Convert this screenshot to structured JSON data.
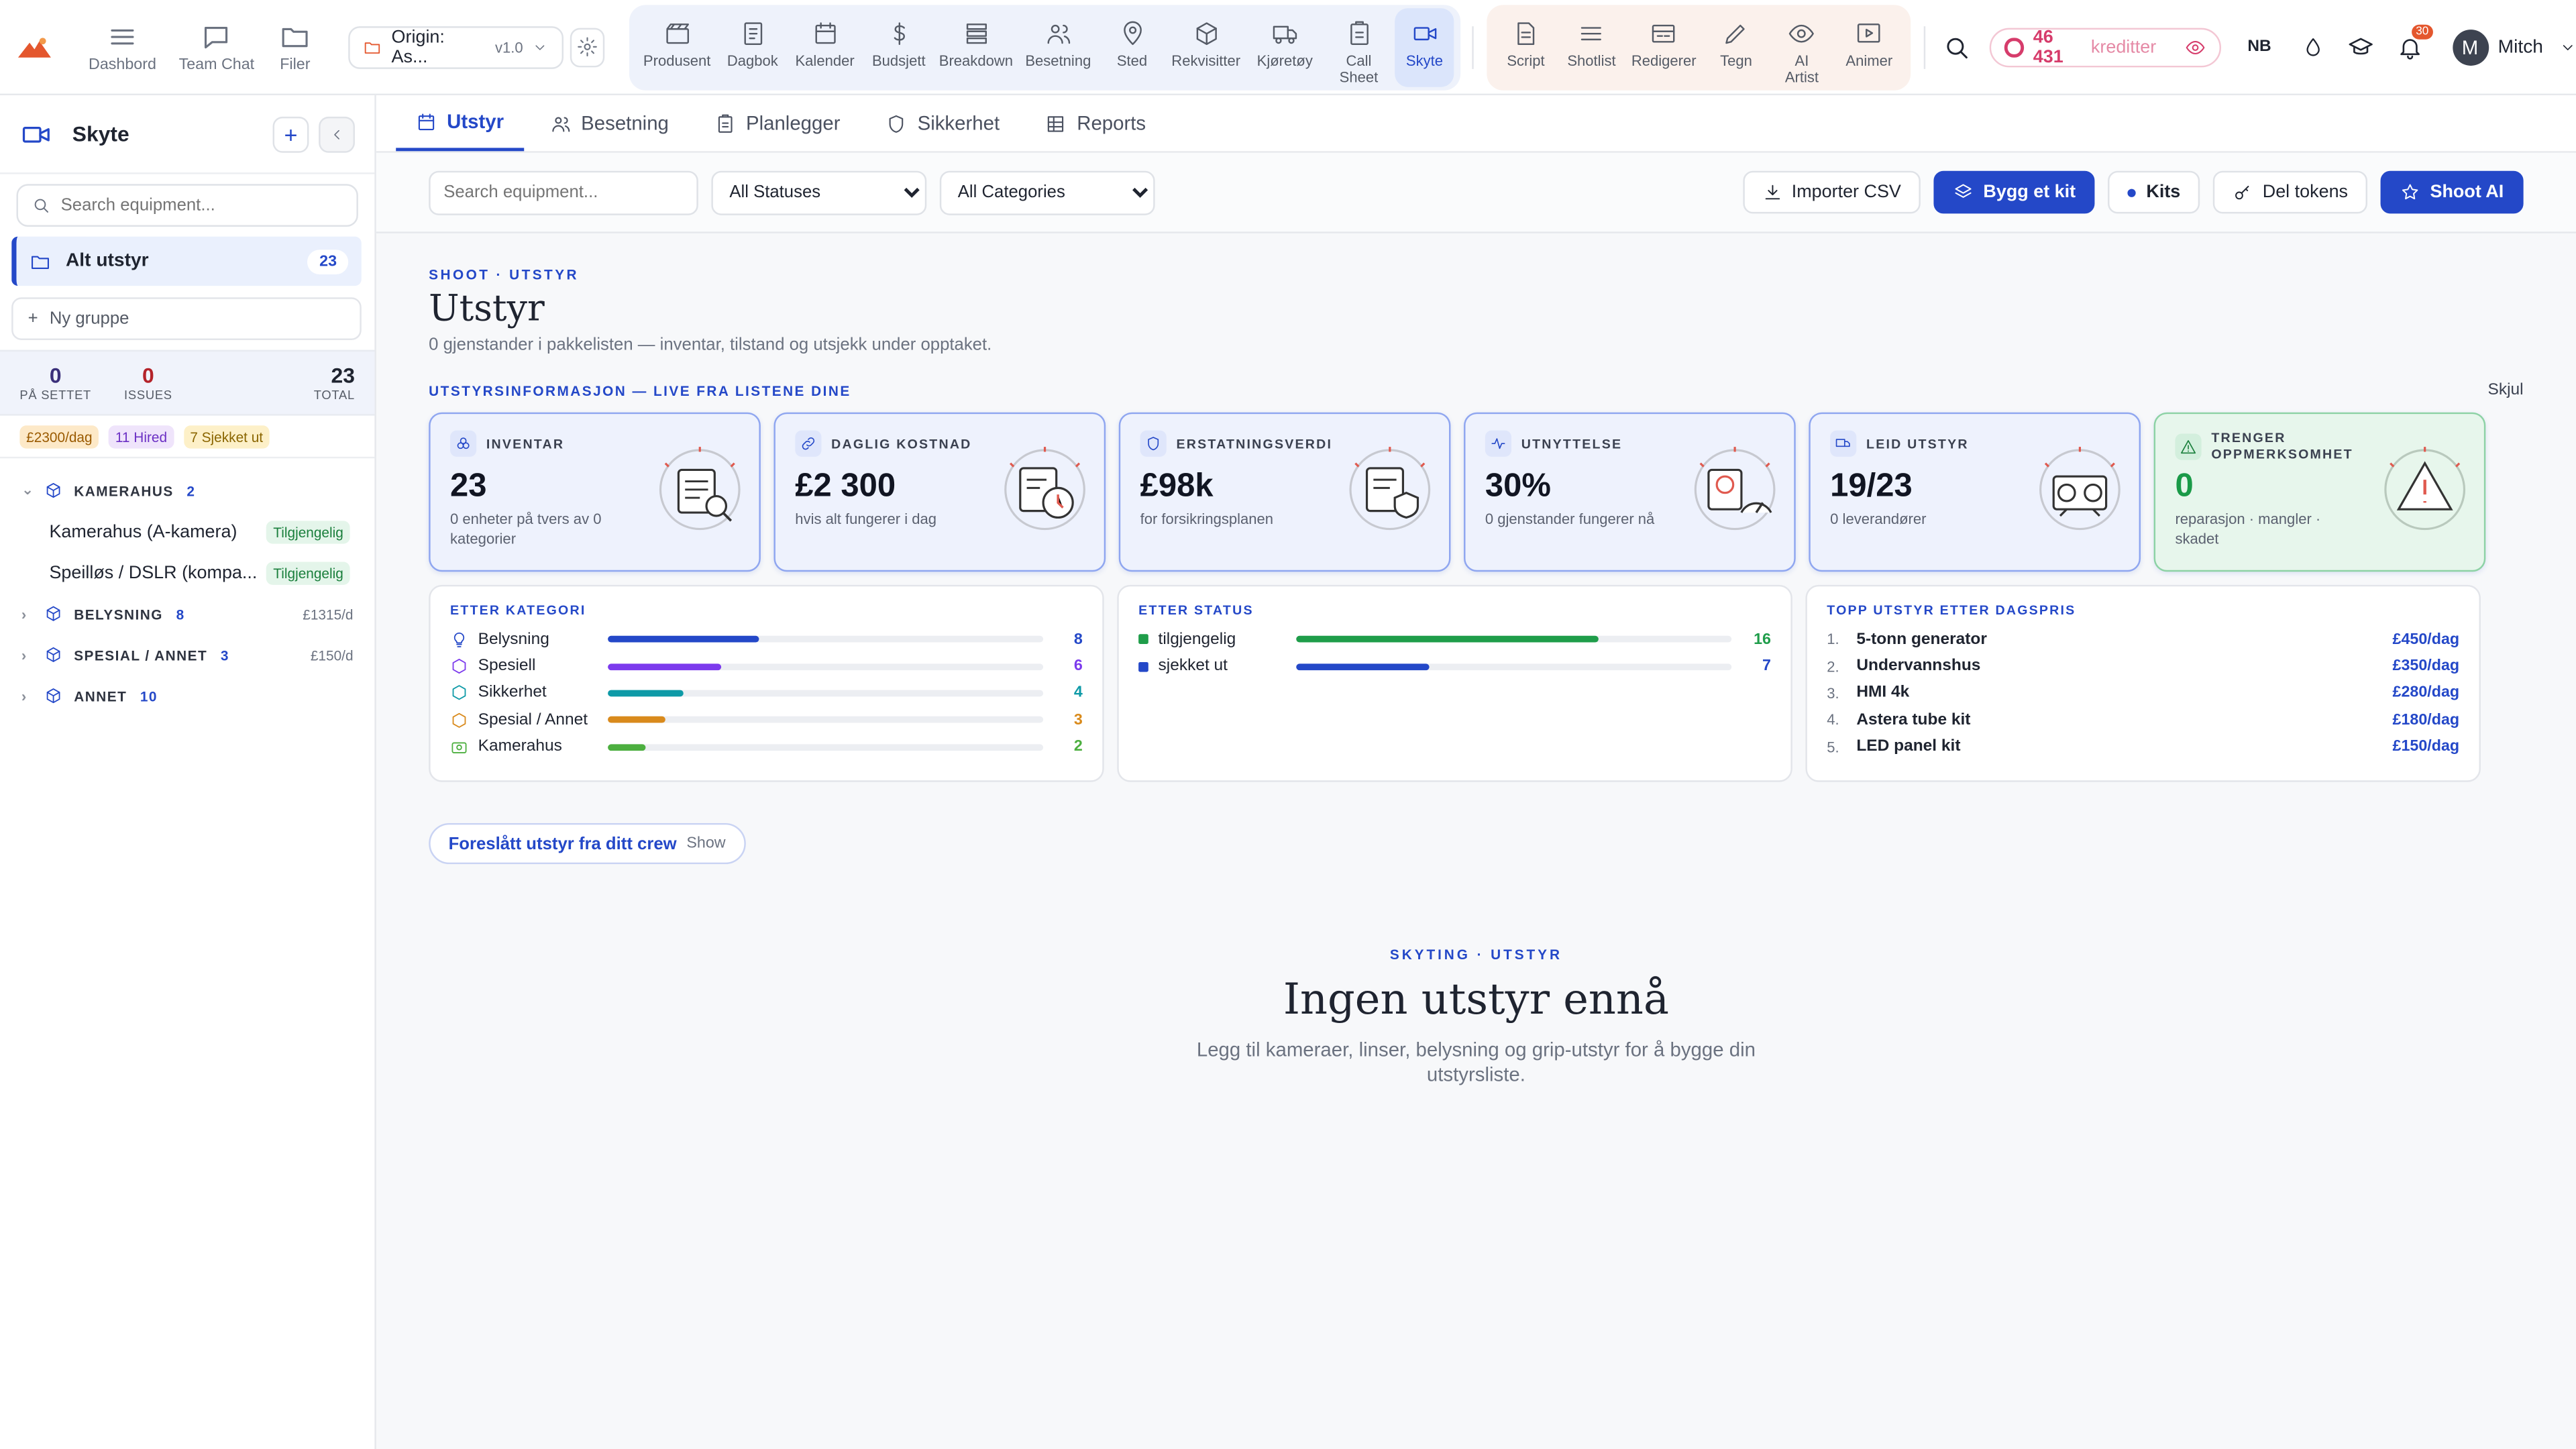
{
  "topnav": {
    "left": [
      {
        "label": "Dashbord",
        "icon": "menu-icon"
      },
      {
        "label": "Team Chat",
        "icon": "chat-icon"
      },
      {
        "label": "Filer",
        "icon": "folder-icon"
      }
    ],
    "project": {
      "name": "Origin: As...",
      "version": "v1.0"
    },
    "tools_blue": [
      {
        "label": "Produsent"
      },
      {
        "label": "Dagbok"
      },
      {
        "label": "Kalender"
      },
      {
        "label": "Budsjett"
      },
      {
        "label": "Breakdown"
      },
      {
        "label": "Besetning"
      },
      {
        "label": "Sted"
      },
      {
        "label": "Rekvisitter"
      },
      {
        "label": "Kjøretøy"
      },
      {
        "label": "Call Sheet"
      },
      {
        "label": "Skyte"
      }
    ],
    "tools_peach": [
      {
        "label": "Script"
      },
      {
        "label": "Shotlist"
      },
      {
        "label": "Redigerer"
      },
      {
        "label": "Tegn"
      },
      {
        "label": "AI Artist"
      },
      {
        "label": "Animer"
      }
    ],
    "credits_amount": "46 431",
    "credits_label": "kreditter",
    "lang": "NB",
    "notif_count": "30",
    "user_initial": "M",
    "user_name": "Mitch",
    "accent": "#2448c8"
  },
  "sidebar": {
    "title": "Skyte",
    "search_placeholder": "Search equipment...",
    "all_label": "Alt utstyr",
    "all_count": "23",
    "new_group": "Ny gruppe",
    "stats": [
      {
        "value": "0",
        "label": "PÅ SETTET"
      },
      {
        "value": "0",
        "label": "ISSUES"
      },
      {
        "value": "23",
        "label": "TOTAL"
      }
    ],
    "tags": [
      "£2300/dag",
      "11 Hired",
      "7 Sjekket ut"
    ],
    "groups": [
      {
        "name": "KAMERAHUS",
        "count": "2",
        "price": "",
        "expanded": true,
        "items": [
          {
            "name": "Kamerahus (A-kamera)",
            "status": "Tilgjengelig"
          },
          {
            "name": "Speilløs / DSLR (kompa...",
            "status": "Tilgjengelig"
          }
        ]
      },
      {
        "name": "BELYSNING",
        "count": "8",
        "price": "£1315/d"
      },
      {
        "name": "SPESIAL / ANNET",
        "count": "3",
        "price": "£150/d"
      },
      {
        "name": "ANNET",
        "count": "10",
        "price": ""
      }
    ]
  },
  "tabs": [
    {
      "label": "Utstyr",
      "active": true
    },
    {
      "label": "Besetning"
    },
    {
      "label": "Planlegger"
    },
    {
      "label": "Sikkerhet"
    },
    {
      "label": "Reports"
    }
  ],
  "toolbar": {
    "search_placeholder": "Search equipment...",
    "status_select": "All Statuses",
    "category_select": "All Categories",
    "import_csv": "Importer CSV",
    "build_kit": "Bygg et kit",
    "kits": "Kits",
    "share_tokens": "Del tokens",
    "shoot_ai": "Shoot AI"
  },
  "header": {
    "eyebrow": "SHOOT · UTSTYR",
    "title": "Utstyr",
    "subtitle": "0 gjenstander i pakkelisten — inventar, tilstand og utsjekk under opptaket."
  },
  "info": {
    "heading": "UTSTYRSINFORMASJON — LIVE FRA LISTENE DINE",
    "hide": "Skjul",
    "cards": [
      {
        "label": "INVENTAR",
        "value": "23",
        "desc": "0 enheter på tvers av 0 kategorier"
      },
      {
        "label": "DAGLIG KOSTNAD",
        "value": "£2 300",
        "desc": "hvis alt fungerer i dag"
      },
      {
        "label": "ERSTATNINGSVERDI",
        "value": "£98k",
        "desc": "for forsikringsplanen"
      },
      {
        "label": "UTNYTTELSE",
        "value": "30%",
        "desc": "0 gjenstander fungerer nå"
      },
      {
        "label": "LEID UTSTYR",
        "value": "19/23",
        "desc": "0 leverandører"
      },
      {
        "label": "TRENGER OPPMERKSOMHET",
        "value": "0",
        "desc": "reparasjon · mangler · skadet"
      }
    ]
  },
  "by_category": {
    "heading": "ETTER KATEGORI",
    "rows": [
      {
        "label": "Belysning",
        "value": 8,
        "color": "#2448c8"
      },
      {
        "label": "Spesiell",
        "value": 6,
        "color": "#7c3aed"
      },
      {
        "label": "Sikkerhet",
        "value": 4,
        "color": "#0e9aa7"
      },
      {
        "label": "Spesial / Annet",
        "value": 3,
        "color": "#d98a1c"
      },
      {
        "label": "Kamerahus",
        "value": 2,
        "color": "#4caf3f"
      }
    ]
  },
  "by_status": {
    "heading": "ETTER STATUS",
    "rows": [
      {
        "label": "tilgjengelig",
        "value": 16,
        "color": "#1f9d4a"
      },
      {
        "label": "sjekket ut",
        "value": 7,
        "color": "#2448c8"
      }
    ]
  },
  "top_price": {
    "heading": "TOPP UTSTYR ETTER DAGSPRIS",
    "rows": [
      {
        "rank": "1.",
        "name": "5-tonn generator",
        "price": "£450/dag"
      },
      {
        "rank": "2.",
        "name": "Undervannshus",
        "price": "£350/dag"
      },
      {
        "rank": "3.",
        "name": "HMI 4k",
        "price": "£280/dag"
      },
      {
        "rank": "4.",
        "name": "Astera tube kit",
        "price": "£180/dag"
      },
      {
        "rank": "5.",
        "name": "LED panel kit",
        "price": "£150/dag"
      }
    ]
  },
  "suggest": {
    "label": "Foreslått utstyr fra ditt crew",
    "action": "Show"
  },
  "empty": {
    "eyebrow": "SKYTING · UTSTYR",
    "title": "Ingen utstyr ennå",
    "desc": "Legg til kameraer, linser, belysning og grip-utstyr for å bygge din utstyrsliste."
  }
}
